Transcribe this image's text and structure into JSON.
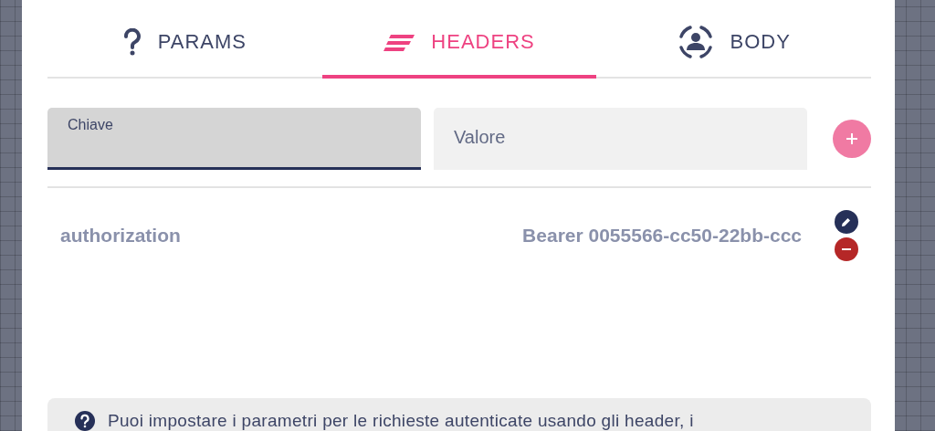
{
  "tabs": [
    {
      "label": "PARAMS",
      "selected": false
    },
    {
      "label": "HEADERS",
      "selected": true
    },
    {
      "label": "BODY",
      "selected": false
    }
  ],
  "key_field": {
    "label": "Chiave",
    "focused": true
  },
  "value_field": {
    "placeholder": "Valore"
  },
  "headers": [
    {
      "key": "authorization",
      "value": "Bearer 0055566-cc50-22bb-ccc"
    }
  ],
  "note": {
    "text": "Puoi impostare i parametri per le richieste autenticate usando gli header, i"
  }
}
